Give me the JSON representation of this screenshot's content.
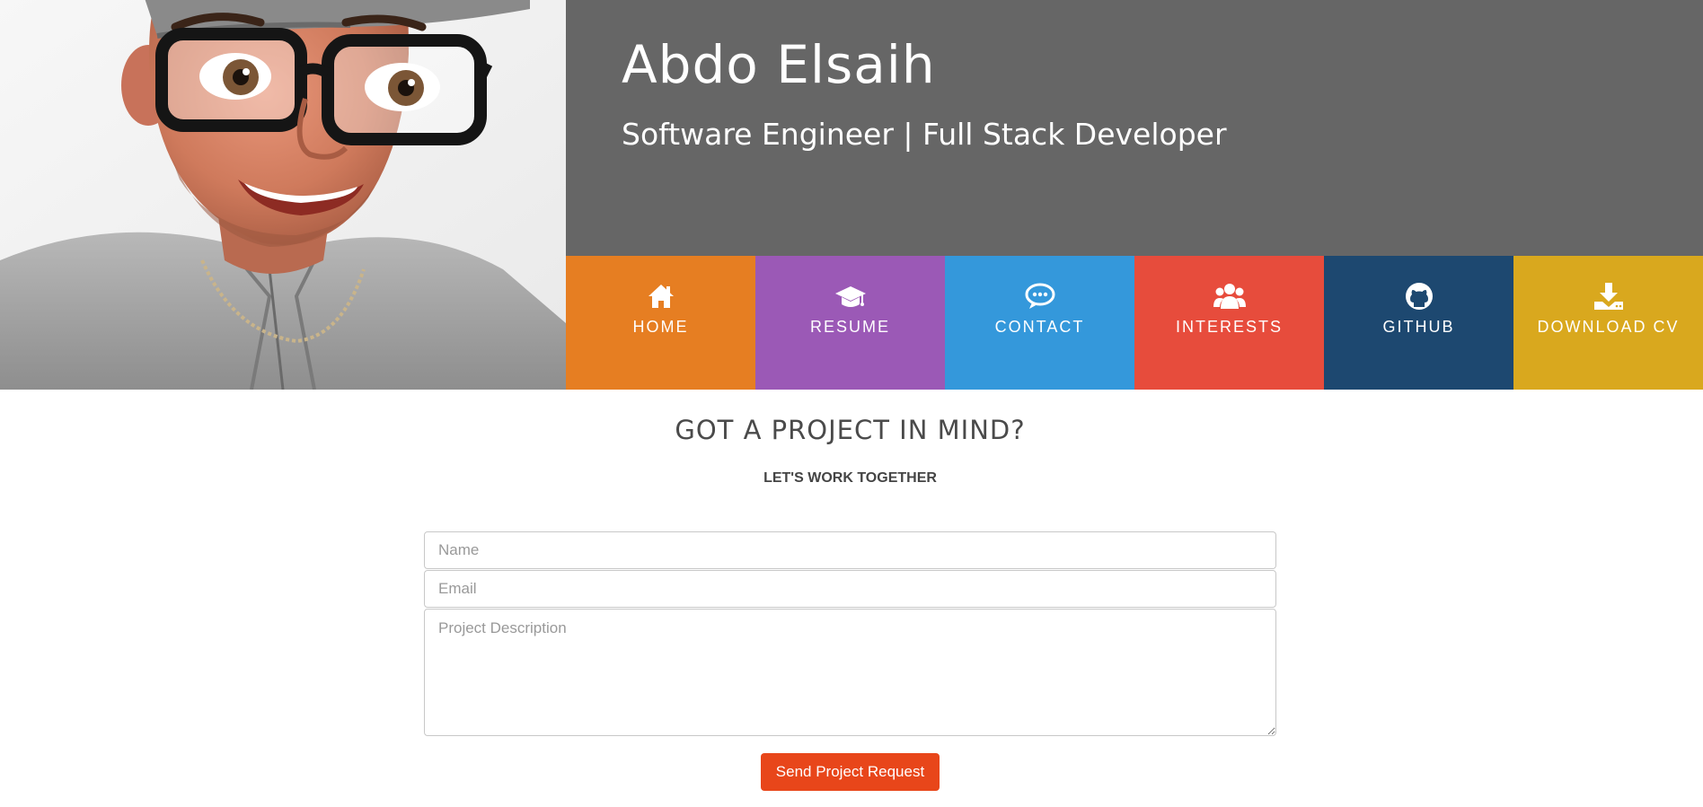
{
  "profile": {
    "name": "Abdo Elsaih",
    "role": "Software Engineer | Full Stack Developer",
    "avatar_icon": "memoji-avatar"
  },
  "colors": {
    "title_panel": "#666666",
    "home": "#e67e22",
    "resume": "#9b59b6",
    "contact": "#3498db",
    "interests": "#e74c3c",
    "github": "#1d4870",
    "download_cv": "#d9a81e",
    "submit_button": "#e8461a"
  },
  "nav": {
    "items": [
      {
        "label": "HOME",
        "icon": "home-icon"
      },
      {
        "label": "RESUME",
        "icon": "graduation-cap-icon"
      },
      {
        "label": "CONTACT",
        "icon": "chat-bubble-icon"
      },
      {
        "label": "INTERESTS",
        "icon": "users-icon"
      },
      {
        "label": "GITHUB",
        "icon": "github-icon"
      },
      {
        "label": "DOWNLOAD CV",
        "icon": "download-icon"
      }
    ]
  },
  "contact": {
    "title": "GOT A PROJECT IN MIND?",
    "subtitle": "LET'S WORK TOGETHER",
    "name_placeholder": "Name",
    "email_placeholder": "Email",
    "description_placeholder": "Project Description",
    "submit_label": "Send Project Request"
  }
}
